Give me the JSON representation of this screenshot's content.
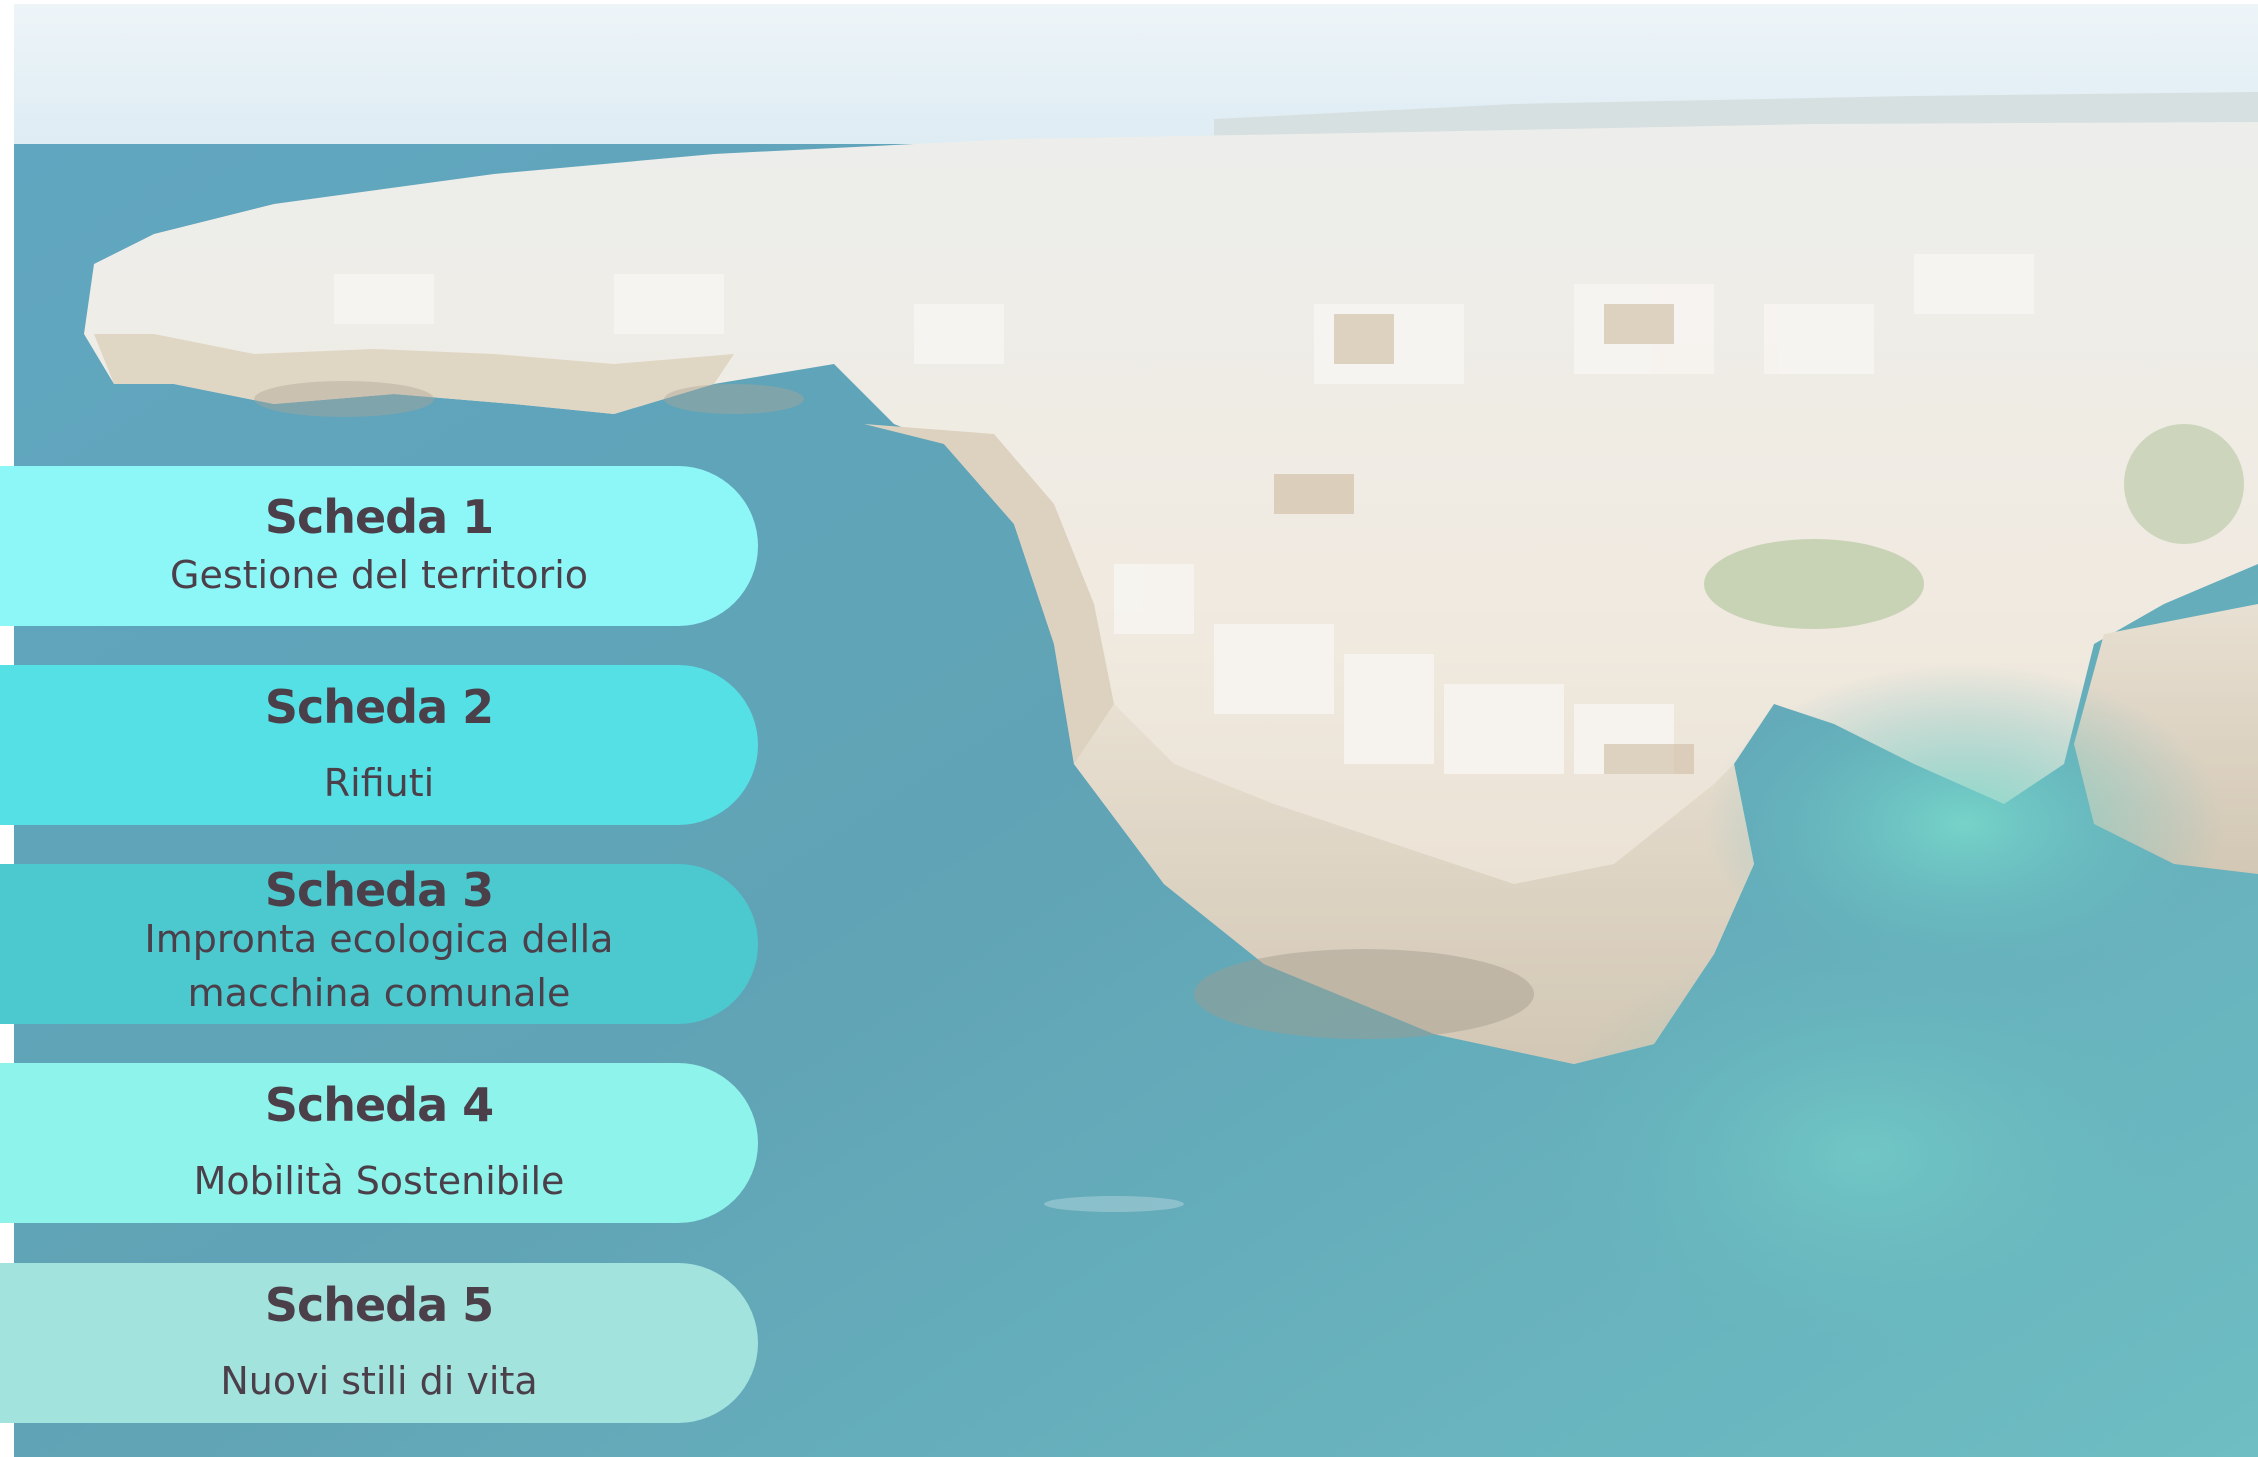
{
  "background": {
    "subject": "aerial-coastal-town-photo",
    "sea_color": "#4fa8b8",
    "sky_color": "#dfeef6",
    "town_color": "#ece6dd"
  },
  "cards": [
    {
      "title": "Scheda 1",
      "subtitle": "Gestione del territorio",
      "color": "#8df7f8"
    },
    {
      "title": "Scheda 2",
      "subtitle": "Rifiuti",
      "color": "#55e0e5"
    },
    {
      "title": "Scheda 3",
      "subtitle": "Impronta ecologica della macchina comunale",
      "color": "#4cc8cf"
    },
    {
      "title": "Scheda 4",
      "subtitle": "Mobilità Sostenibile",
      "color": "#8ef3ea"
    },
    {
      "title": "Scheda 5",
      "subtitle": "Nuovi stili di vita",
      "color": "#a3e3de"
    }
  ]
}
